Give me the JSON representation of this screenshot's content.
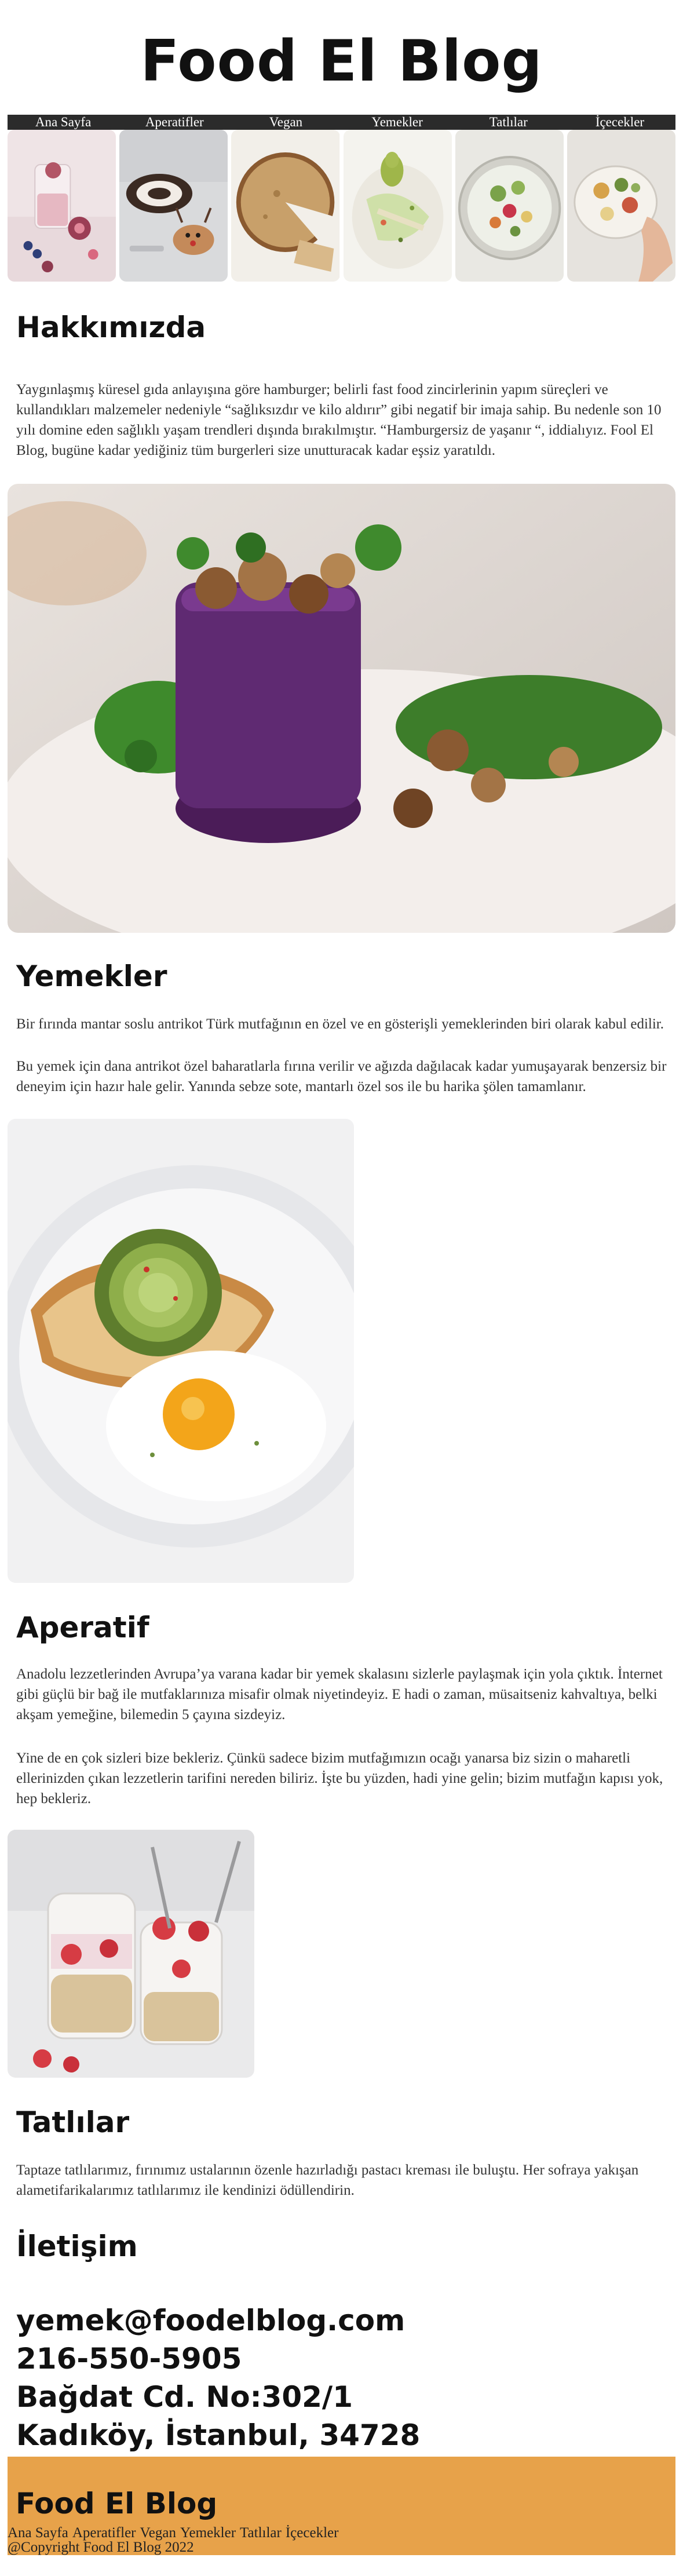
{
  "site": {
    "title": "Food El Blog"
  },
  "nav": {
    "items": [
      "Ana Sayfa",
      "Aperatifler",
      "Vegan",
      "Yemekler",
      "Tatlılar",
      "İçecekler"
    ]
  },
  "gallery": {
    "images": [
      "figs-and-berries-photo",
      "cake-roll-photo",
      "cheesecake-slice-photo",
      "salad-with-pear-photo",
      "glass-bowl-salad-photo",
      "hand-holding-bowl-photo"
    ]
  },
  "about": {
    "heading": "Hakkımızda",
    "paragraph": "Yaygınlaşmış küresel gıda anlayışına göre hamburger; belirli fast food zincirlerinin yapım süreçleri ve kullandıkları malzemeler nedeniyle “sağlıksızdır ve kilo aldırır” gibi negatif bir imaja sahip. Bu nedenle son 10 yılı domine eden sağlıklı yaşam trendleri dışında bırakılmıştır. “Hamburgersiz de yaşanır “, iddialıyız. Fool El Blog, bugüne kadar yediğiniz tüm burgerleri size unutturacak kadar eşsiz yaratıldı."
  },
  "dishes": {
    "heading": "Yemekler",
    "paragraph1": "Bir fırında mantar soslu antrikot Türk mutfağının en özel ve en gösterişli yemeklerinden biri olarak kabul edilir.",
    "paragraph2": "Bu yemek için dana antrikot özel baharatlarla fırına verilir ve ağızda dağılacak kadar yumuşayarak benzersiz bir deneyim için hazır hale gelir. Yanında sebze sote, mantarlı özel sos ile bu harika şölen tamamlanır."
  },
  "appetizer": {
    "heading": "Aperatif",
    "paragraph1": "Anadolu lezzetlerinden Avrupa’ya varana kadar bir yemek skalasını sizlerle paylaşmak için yola çıktık. İnternet gibi güçlü bir bağ ile mutfaklarınıza misafir olmak niyetindeyiz. E hadi o zaman, müsaitseniz kahvaltıya, belki akşam yemeğine, bilemedin 5 çayına sizdeyiz.",
    "paragraph2": "Yine de en çok sizleri bize bekleriz. Çünkü sadece bizim mutfağımızın ocağı yanarsa biz sizin o maharetli ellerinizden çıkan lezzetlerin tarifini nereden biliriz. İşte bu yüzden, hadi yine gelin; bizim mutfağın kapısı yok, hep bekleriz."
  },
  "desserts": {
    "heading": "Tatlılar",
    "paragraph": "Taptaze tatlılarımız, fırınımız ustalarının özenle hazırladığı pastacı kreması ile buluştu. Her sofraya yakışan alametifarikalarımız tatlılarımız ile kendinizi ödüllendirin."
  },
  "contact": {
    "heading": "İletişim",
    "email": "yemek@foodelblog.com",
    "phone": "216-550-5905",
    "address1": "Bağdat Cd. No:302/1",
    "address2": "Kadıköy, İstanbul, 34728"
  },
  "footer": {
    "title": "Food El Blog",
    "links": [
      "Ana Sayfa",
      "Aperatifler",
      "Vegan",
      "Yemekler",
      "Tatlılar",
      "İçecekler"
    ],
    "copyright": "@Copyright Food El Blog 2022"
  },
  "colors": {
    "nav_background": "#2b2b2b",
    "footer_background": "#e7a24a",
    "heading_text": "#111111",
    "body_text": "#333333"
  }
}
